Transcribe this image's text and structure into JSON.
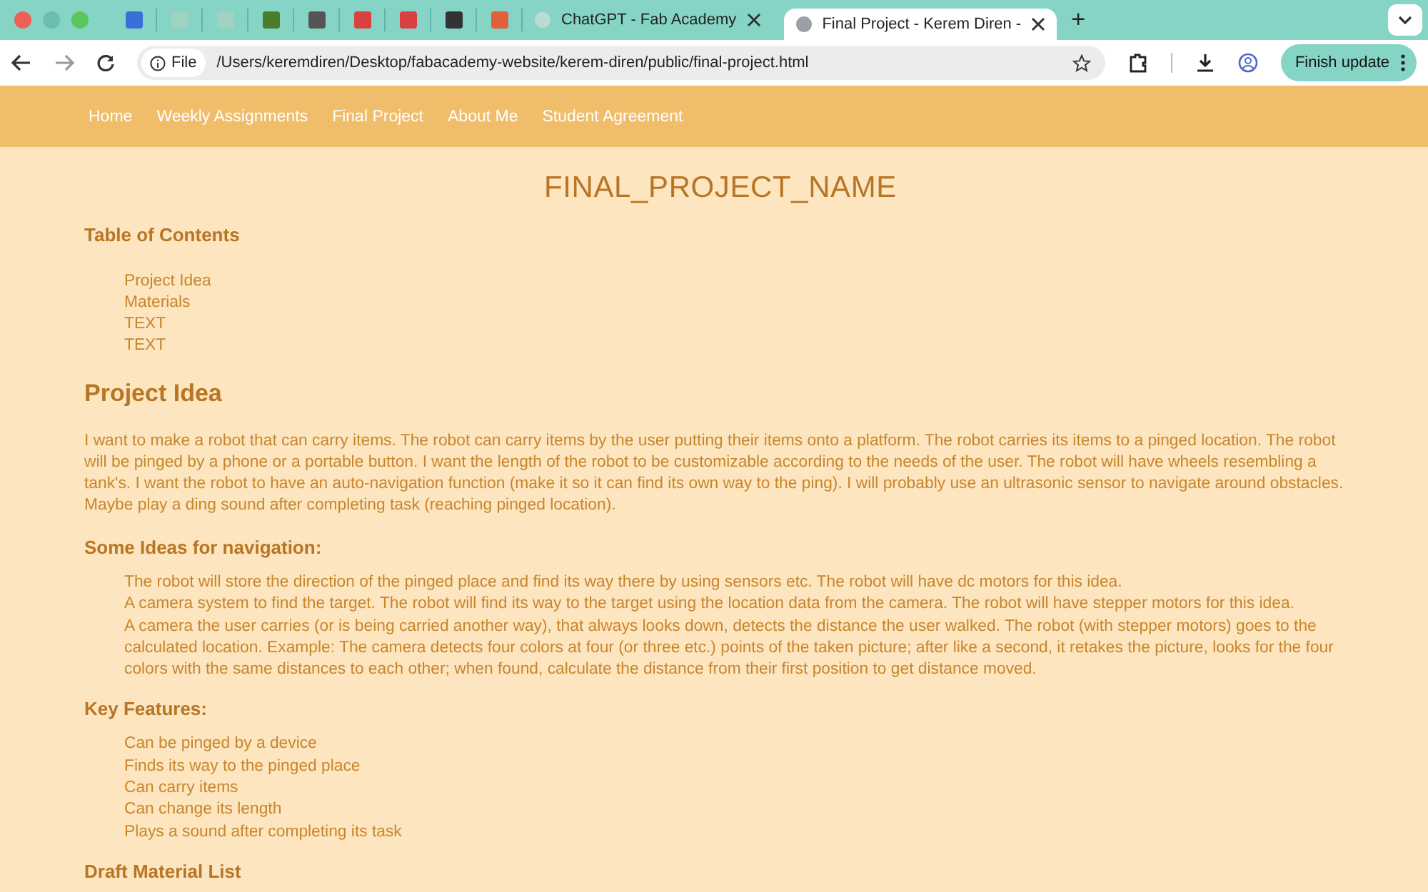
{
  "browser": {
    "pinned_tabs": [
      {
        "color": "#3b6fd8"
      },
      {
        "color": "#9fd3c0"
      },
      {
        "color": "#9fd3c0"
      },
      {
        "color": "#4a7d2a"
      },
      {
        "color": "#555555"
      },
      {
        "color": "#d94040"
      },
      {
        "color": "#d94040"
      },
      {
        "color": "#333333"
      },
      {
        "color": "#e0603a"
      }
    ],
    "tabs": [
      {
        "title": "ChatGPT - Fab Academy",
        "selected": false
      },
      {
        "title": "Final Project - Kerem Diren - ",
        "selected": true
      }
    ],
    "new_tab": "+",
    "address_scheme": "File",
    "address": "/Users/keremdiren/Desktop/fabacademy-website/kerem-diren/public/final-project.html",
    "update_button": "Finish update"
  },
  "nav": [
    {
      "label": "Home"
    },
    {
      "label": "Weekly Assignments"
    },
    {
      "label": "Final Project"
    },
    {
      "label": "About Me"
    },
    {
      "label": "Student Agreement"
    }
  ],
  "page": {
    "title": "FINAL_PROJECT_NAME",
    "toc": {
      "heading": "Table of Contents",
      "items": [
        "Project Idea",
        "Materials",
        "TEXT",
        "TEXT"
      ]
    },
    "sections": [
      {
        "kind": "h2",
        "text": "Project Idea"
      },
      {
        "kind": "p",
        "text": "I want to make a robot that can carry items. The robot can carry items by the user putting their items onto a platform. The robot carries its items to a pinged location. The robot will be pinged by a phone or a portable button. I want the length of the robot to be customizable according to the needs of the user. The robot will have wheels resembling a tank's. I want the robot to have an auto-navigation function (make it so it can find its own way to the ping). I will probably use an ultrasonic sensor to navigate around obstacles. Maybe play a ding sound after completing task (reaching pinged location)."
      },
      {
        "kind": "h3",
        "text": "Some Ideas for navigation:"
      },
      {
        "kind": "list",
        "items": [
          "The robot will store the direction of the pinged place and find its way there by using sensors etc. The robot will have dc motors for this idea.",
          "A camera system to find the target. The robot will find its way to the target using the location data from the camera. The robot will have stepper motors for this idea.",
          "A camera the user carries (or is being carried another way), that always looks down, detects the distance the user walked. The robot (with stepper motors) goes to the calculated location. Example: The camera detects four colors at four (or three etc.) points of the taken picture; after like a second, it retakes the picture, looks for the four colors with the same distances to each other; when found, calculate the distance from their first position to get distance moved."
        ]
      },
      {
        "kind": "h3",
        "text": "Key Features:"
      },
      {
        "kind": "list",
        "items": [
          "Can be pinged by a device",
          "Finds its way to the pinged place",
          "Can carry items",
          "Can change its length",
          "Plays a sound after completing its task"
        ]
      },
      {
        "kind": "h3",
        "text": "Draft Material List"
      }
    ]
  }
}
